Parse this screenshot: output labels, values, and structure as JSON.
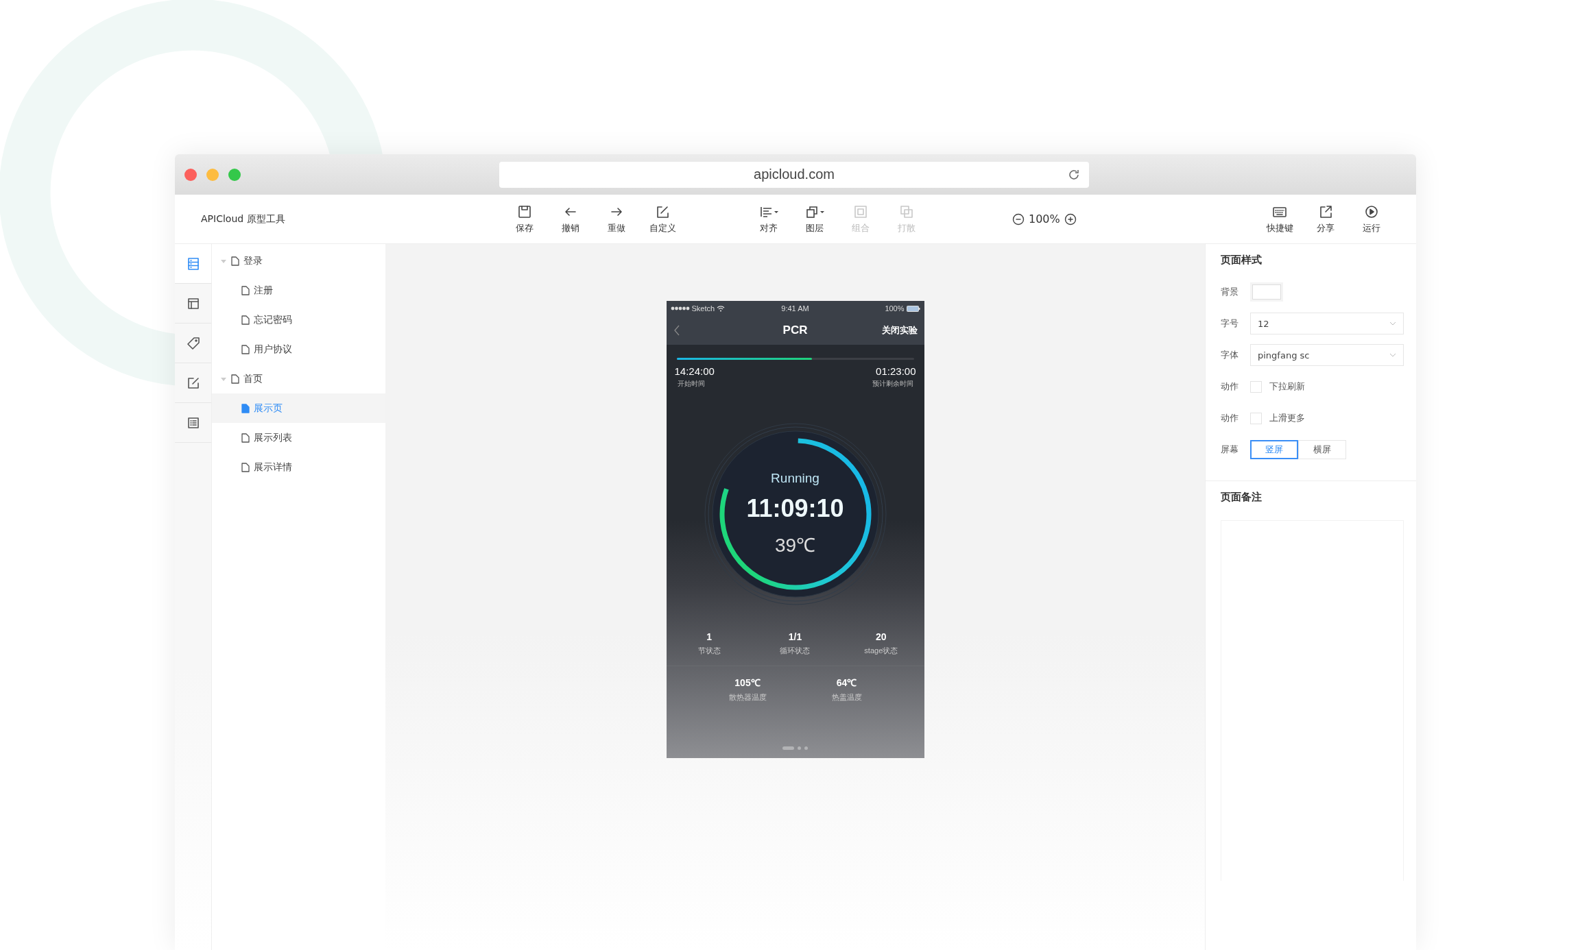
{
  "browser": {
    "url": "apicloud.com"
  },
  "toolbar": {
    "title": "APICloud 原型工具",
    "groups": [
      [
        {
          "kind": "save",
          "label": "保存",
          "disabled": false
        },
        {
          "kind": "undo",
          "label": "撤销",
          "disabled": false
        },
        {
          "kind": "redo",
          "label": "重做",
          "disabled": false
        },
        {
          "kind": "custom",
          "label": "自定义",
          "disabled": false
        }
      ],
      [
        {
          "kind": "align",
          "label": "对齐",
          "disabled": false
        },
        {
          "kind": "layer",
          "label": "图层",
          "disabled": false
        },
        {
          "kind": "group",
          "label": "组合",
          "disabled": true
        },
        {
          "kind": "ungroup",
          "label": "打散",
          "disabled": true
        }
      ],
      [
        {
          "kind": "keyboard",
          "label": "快捷键",
          "disabled": false
        },
        {
          "kind": "share",
          "label": "分享",
          "disabled": false
        },
        {
          "kind": "run",
          "label": "运行",
          "disabled": false
        }
      ]
    ],
    "zoom": "100%"
  },
  "rail": [
    {
      "kind": "pages",
      "selected": true
    },
    {
      "kind": "layout",
      "selected": false
    },
    {
      "kind": "tag",
      "selected": false
    },
    {
      "kind": "edit",
      "selected": false
    },
    {
      "kind": "list",
      "selected": false
    }
  ],
  "tree": [
    {
      "label": "登录",
      "selected": false,
      "expanded": true,
      "children": [
        {
          "label": "注册",
          "selected": false
        },
        {
          "label": "忘记密码",
          "selected": false
        },
        {
          "label": "用户协议",
          "selected": false
        }
      ]
    },
    {
      "label": "首页",
      "selected": false,
      "expanded": true,
      "children": [
        {
          "label": "展示页",
          "selected": true
        },
        {
          "label": "展示列表",
          "selected": false
        },
        {
          "label": "展示详情",
          "selected": false
        }
      ]
    }
  ],
  "phone": {
    "carrier": "Sketch",
    "clock": "9:41 AM",
    "battery": "100%",
    "title": "PCR",
    "action": "关闭实验",
    "progress": {
      "level": 0.57
    },
    "start": {
      "value": "14:24:00",
      "label": "开始时间"
    },
    "remaining": {
      "value": "01:23:00",
      "label": "预计剩余时间"
    },
    "dial": {
      "status": "Running",
      "time": "11:09:10",
      "temperature": "39℃"
    },
    "stats": [
      {
        "value": "1",
        "label": "节状态"
      },
      {
        "value": "1/1",
        "label": "循环状态"
      },
      {
        "value": "20",
        "label": "stage状态"
      }
    ],
    "temperatures": [
      {
        "value": "105℃",
        "label": "散热器温度"
      },
      {
        "value": "64℃",
        "label": "热盖温度"
      }
    ],
    "pages": [
      {
        "selected": true
      },
      {
        "selected": false
      },
      {
        "selected": false
      }
    ]
  },
  "properties": {
    "title": "页面样式",
    "fields": [
      {
        "kind": "color",
        "label": "背景"
      },
      {
        "kind": "select",
        "label": "字号",
        "value": "12"
      },
      {
        "kind": "select",
        "label": "字体",
        "value": "pingfang sc"
      },
      {
        "kind": "checkbox",
        "label": "动作",
        "text": "下拉刷新",
        "checked": false
      },
      {
        "kind": "checkbox",
        "label": "动作",
        "text": "上滑更多",
        "checked": false
      },
      {
        "kind": "segmented",
        "label": "屏幕",
        "options": [
          {
            "label": "竖屏",
            "selected": true
          },
          {
            "label": "横屏",
            "selected": false
          }
        ]
      }
    ],
    "notes": {
      "title": "页面备注"
    }
  }
}
